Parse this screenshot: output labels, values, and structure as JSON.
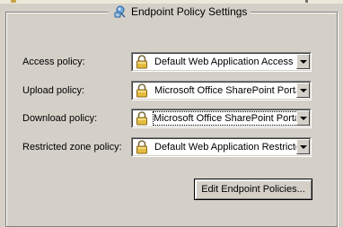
{
  "group": {
    "title": "Endpoint Policy Settings",
    "icon": "endpoint-policy-icon"
  },
  "fields": [
    {
      "label": "Access policy:",
      "value": "Default Web Application Access",
      "icon": "lock-icon",
      "selected": false
    },
    {
      "label": "Upload policy:",
      "value": "Microsoft Office SharePoint Portal",
      "icon": "lock-icon",
      "selected": false
    },
    {
      "label": "Download policy:",
      "value": "Microsoft Office SharePoint Portal",
      "icon": "lock-icon",
      "selected": true
    },
    {
      "label": "Restricted zone policy:",
      "value": "Default Web Application Restricted",
      "icon": "lock-icon",
      "selected": false
    }
  ],
  "buttons": {
    "edit_label": "Edit Endpoint Policies..."
  },
  "colors": {
    "face": "#d4d0c8",
    "selection": "#0a246a",
    "lock_gold": "#d9b13a"
  }
}
